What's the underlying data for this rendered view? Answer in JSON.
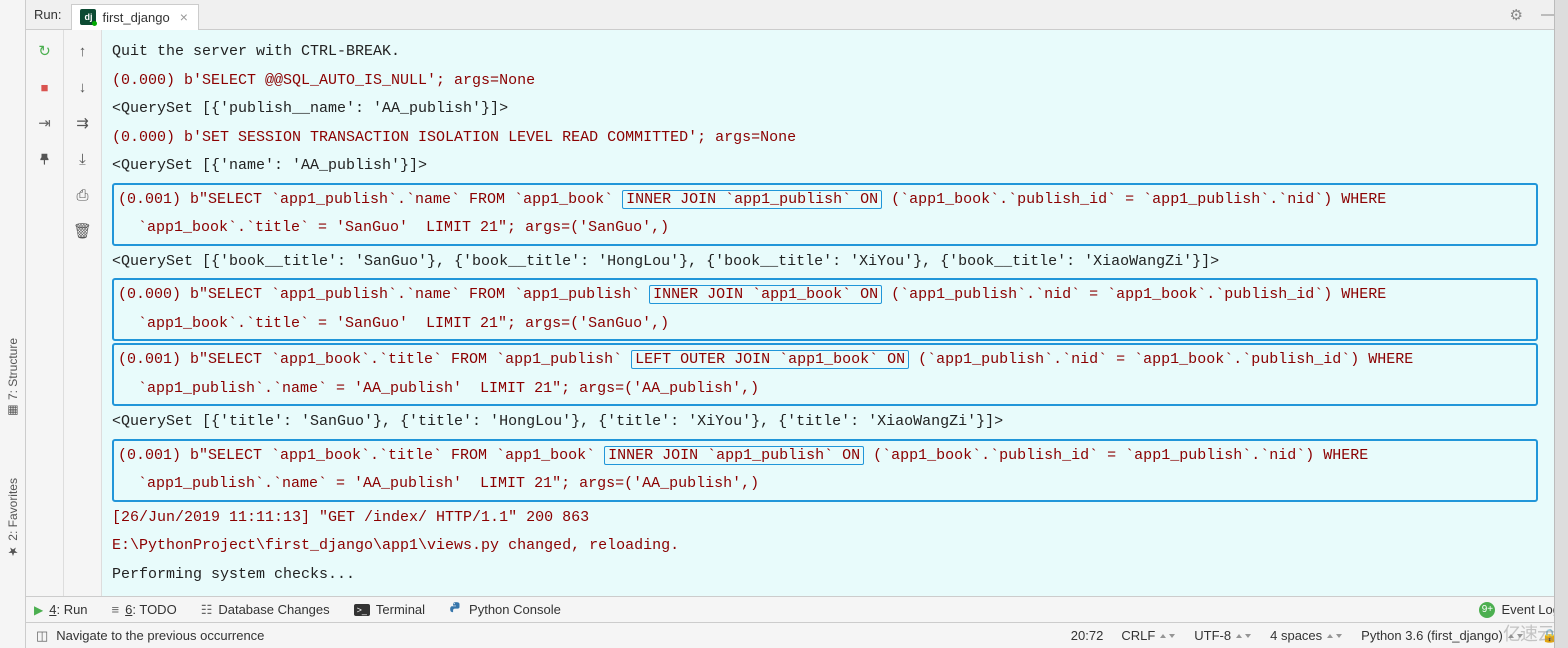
{
  "header": {
    "run_label": "Run:",
    "tab_name": "first_django",
    "dj_text": "dj"
  },
  "sidebar": {
    "structure": "7: Structure",
    "favorites": "2: Favorites"
  },
  "console": {
    "line1": "Quit the server with CTRL-BREAK.",
    "line2": "(0.000) b'SELECT @@SQL_AUTO_IS_NULL'; args=None",
    "line3": "<QuerySet [{'publish__name': 'AA_publish'}]>",
    "line4": "(0.000) b'SET SESSION TRANSACTION ISOLATION LEVEL READ COMMITTED'; args=None",
    "line5": "<QuerySet [{'name': 'AA_publish'}]>",
    "block1_a": "(0.001) b\"SELECT `app1_publish`.`name` FROM `app1_book` ",
    "block1_kw": "INNER JOIN `app1_publish` ON",
    "block1_b": " (`app1_book`.`publish_id` = `app1_publish`.`nid`) WHERE",
    "block1_c": "`app1_book`.`title` = 'SanGuo'  LIMIT 21\"; args=('SanGuo',)",
    "line6": "<QuerySet [{'book__title': 'SanGuo'}, {'book__title': 'HongLou'}, {'book__title': 'XiYou'}, {'book__title': 'XiaoWangZi'}]>",
    "block2_a": "(0.000) b\"SELECT `app1_publish`.`name` FROM `app1_publish` ",
    "block2_kw": "INNER JOIN `app1_book` ON",
    "block2_b": " (`app1_publish`.`nid` = `app1_book`.`publish_id`) WHERE",
    "block2_c": "`app1_book`.`title` = 'SanGuo'  LIMIT 21\"; args=('SanGuo',)",
    "block3_a": "(0.001) b\"SELECT `app1_book`.`title` FROM `app1_publish` ",
    "block3_kw": "LEFT OUTER JOIN `app1_book` ON",
    "block3_b": " (`app1_publish`.`nid` = `app1_book`.`publish_id`) WHERE",
    "block3_c": "`app1_publish`.`name` = 'AA_publish'  LIMIT 21\"; args=('AA_publish',)",
    "line7": "<QuerySet [{'title': 'SanGuo'}, {'title': 'HongLou'}, {'title': 'XiYou'}, {'title': 'XiaoWangZi'}]>",
    "block4_a": "(0.001) b\"SELECT `app1_book`.`title` FROM `app1_book` ",
    "block4_kw": "INNER JOIN `app1_publish` ON",
    "block4_b": " (`app1_book`.`publish_id` = `app1_publish`.`nid`) WHERE",
    "block4_c": "`app1_publish`.`name` = 'AA_publish'  LIMIT 21\"; args=('AA_publish',)",
    "line8": "[26/Jun/2019 11:11:13] \"GET /index/ HTTP/1.1\" 200 863",
    "line9": "E:\\PythonProject\\first_django\\app1\\views.py changed, reloading.",
    "line10": "Performing system checks..."
  },
  "bottom": {
    "run": "4: Run",
    "todo": "6: TODO",
    "db": "Database Changes",
    "terminal": "Terminal",
    "pyconsole": "Python Console",
    "eventlog": "Event Log",
    "badge": "9+"
  },
  "status": {
    "navigate": "Navigate to the previous occurrence",
    "pos": "20:72",
    "crlf": "CRLF",
    "enc": "UTF-8",
    "indent": "4 spaces",
    "interpreter": "Python 3.6 (first_django)"
  },
  "watermark": "亿速云"
}
